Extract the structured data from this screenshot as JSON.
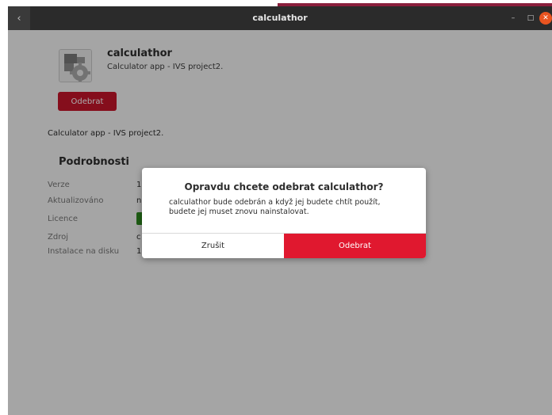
{
  "window": {
    "title": "calculathor"
  },
  "app": {
    "name": "calculathor",
    "summary": "Calculator app - IVS project2.",
    "remove_label": "Odebrat",
    "description": "Calculator app - IVS project2."
  },
  "details": {
    "heading": "Podrobnosti",
    "rows": [
      {
        "label": "Verze",
        "value": "1"
      },
      {
        "label": "Aktualizováno",
        "value": "n"
      },
      {
        "label": "Licence",
        "value": ""
      },
      {
        "label": "Zdroj",
        "value": "c"
      },
      {
        "label": "Instalace na disku",
        "value": "1"
      }
    ]
  },
  "dialog": {
    "title": "Opravdu chcete odebrat calculathor?",
    "message": "calculathor bude odebrán a když jej budete chtít použít, budete jej muset znovu nainstalovat.",
    "cancel_label": "Zrušit",
    "confirm_label": "Odebrat"
  },
  "icons": {
    "back": "chevron-left-icon",
    "minimize": "minimize-icon",
    "maximize": "maximize-icon",
    "close": "close-icon",
    "app": "gear-app-icon"
  },
  "colors": {
    "accent_red": "#c7162b",
    "confirm_red": "#e0182f",
    "close_orange": "#e95420",
    "licence_green": "#2e8b1f"
  }
}
